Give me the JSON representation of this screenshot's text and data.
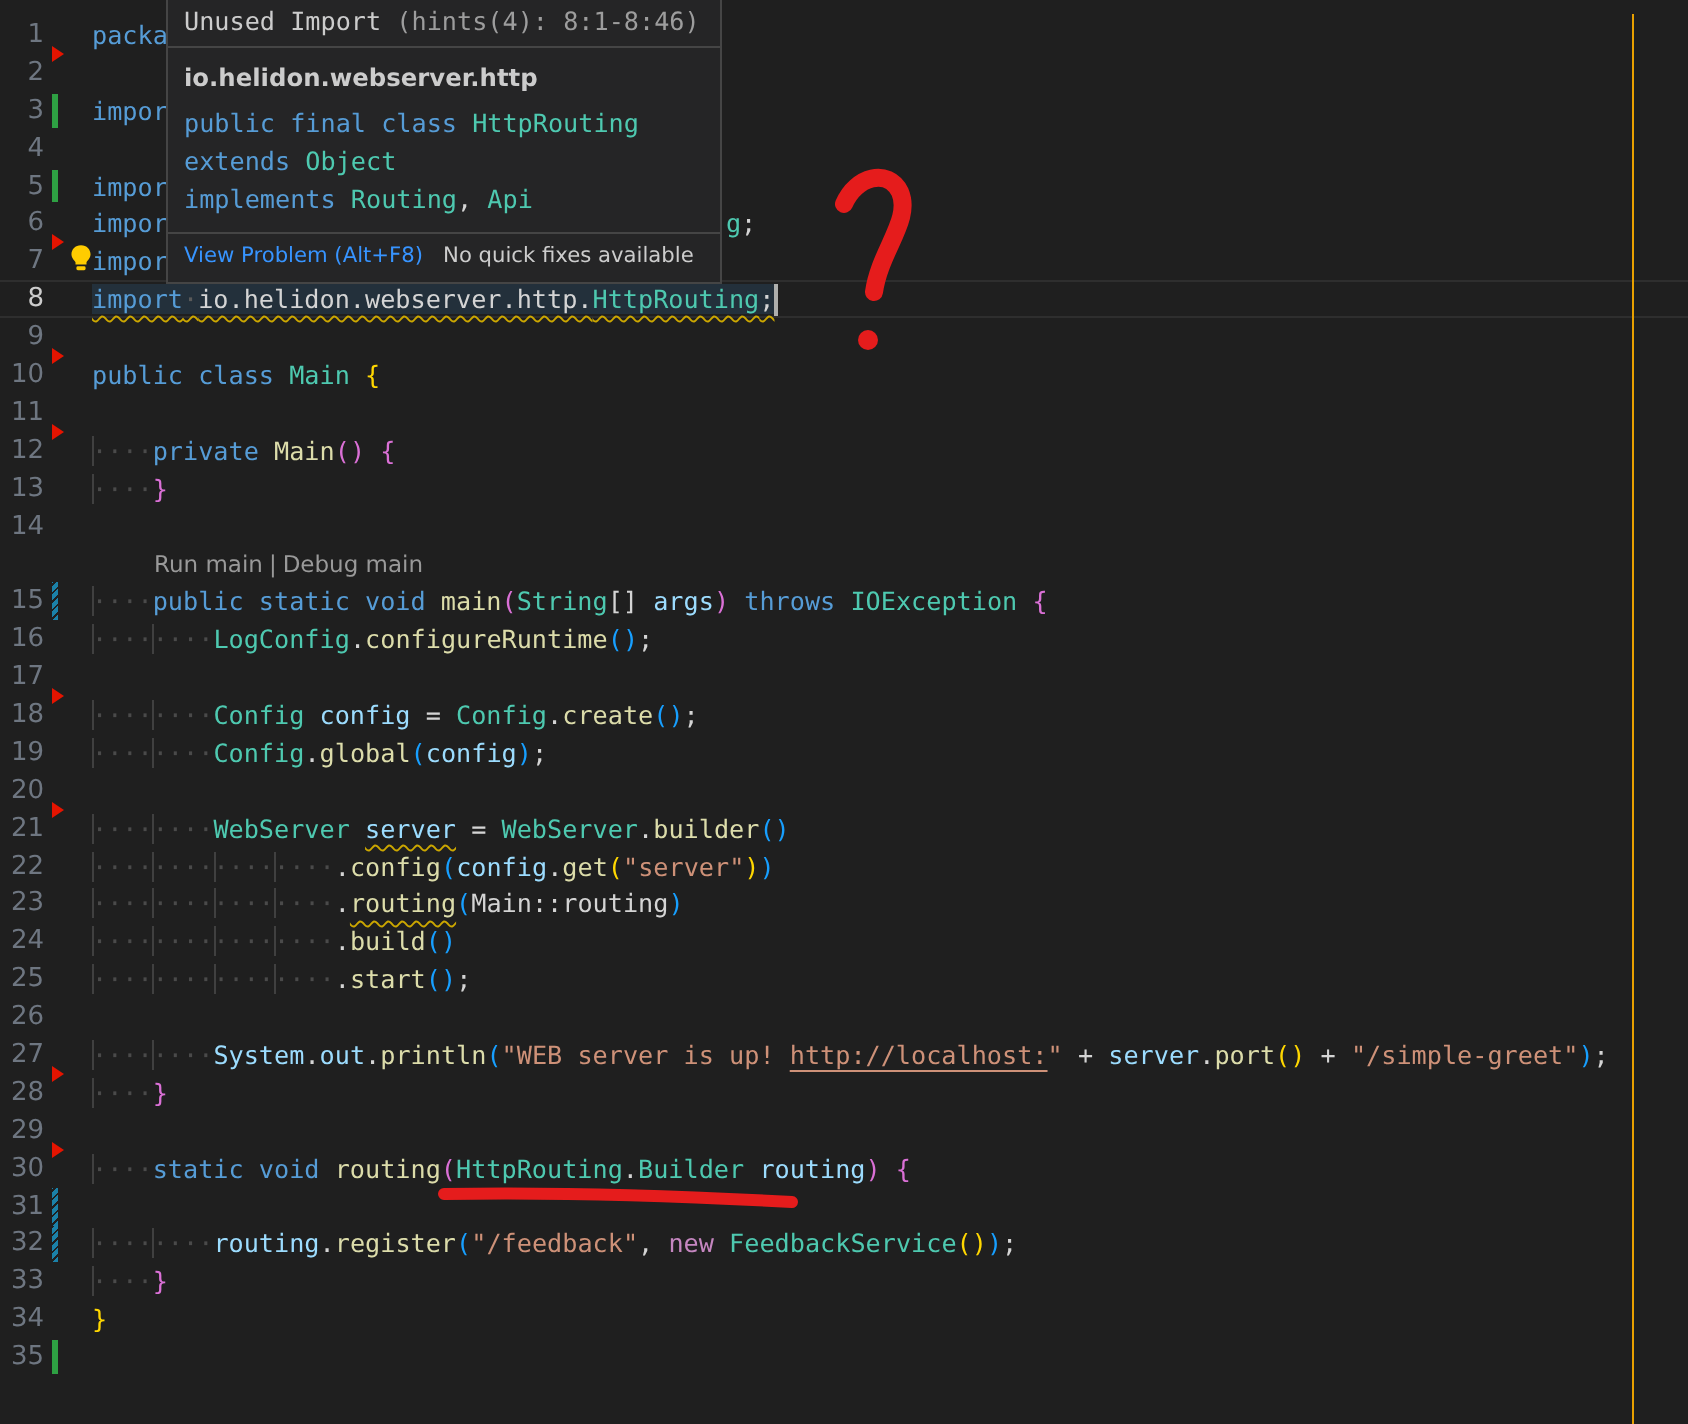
{
  "editor": {
    "lines": [
      {
        "kind": "code",
        "number": "1",
        "selected": false,
        "gutter": {
          "kind": "arrow"
        },
        "tokens": [
          {
            "text": "packa",
            "kind": "keyword"
          }
        ]
      },
      {
        "kind": "code",
        "number": "2",
        "selected": false
      },
      {
        "kind": "code",
        "number": "3",
        "selected": false,
        "gutter": {
          "kind": "added"
        },
        "tokens": [
          {
            "text": "impor",
            "kind": "keyword"
          }
        ]
      },
      {
        "kind": "code",
        "number": "4",
        "selected": false
      },
      {
        "kind": "code",
        "number": "5",
        "selected": false,
        "gutter": {
          "kind": "added"
        },
        "tokens": [
          {
            "text": "impor",
            "kind": "keyword"
          }
        ]
      },
      {
        "kind": "code",
        "number": "6",
        "selected": false,
        "gutter": {
          "kind": "arrow"
        },
        "tokens": [
          {
            "text": "impor",
            "kind": "keyword"
          },
          {
            "text": "g",
            "kind": "type",
            "beyond_popup": true
          },
          {
            "text": ";",
            "kind": "plain"
          }
        ]
      },
      {
        "kind": "code",
        "number": "7",
        "selected": false,
        "lightbulb": true,
        "tokens": [
          {
            "text": "impor",
            "kind": "keyword"
          }
        ]
      },
      {
        "kind": "code",
        "number": "8",
        "selected": true,
        "tokens": [
          {
            "text": "import",
            "kind": "keyword",
            "squiggle": true
          },
          {
            "text": "·",
            "kind": "space",
            "squiggle": true
          },
          {
            "text": "io.helidon.webserver.http.",
            "kind": "plain",
            "squiggle": true
          },
          {
            "text": "HttpRouting",
            "kind": "type",
            "squiggle": true
          },
          {
            "text": ";",
            "kind": "plain",
            "squiggle": true
          }
        ]
      },
      {
        "kind": "code",
        "number": "9",
        "selected": false,
        "gutter": {
          "kind": "arrow"
        }
      },
      {
        "kind": "code",
        "number": "10",
        "selected": false,
        "tokens": [
          {
            "text": "public class ",
            "kind": "keyword"
          },
          {
            "text": "Main ",
            "kind": "type"
          },
          {
            "text": "{",
            "kind": "bracket1"
          }
        ]
      },
      {
        "kind": "code",
        "number": "11",
        "selected": false,
        "gutter": {
          "kind": "arrow"
        }
      },
      {
        "kind": "code",
        "number": "12",
        "selected": false,
        "tokens": [
          {
            "text": "····",
            "kind": "indent"
          },
          {
            "text": "private ",
            "kind": "keyword"
          },
          {
            "text": "Main",
            "kind": "function"
          },
          {
            "text": "() {",
            "kind": "bracket2"
          }
        ]
      },
      {
        "kind": "code",
        "number": "13",
        "selected": false,
        "tokens": [
          {
            "text": "····",
            "kind": "indent"
          },
          {
            "text": "}",
            "kind": "bracket2"
          }
        ]
      },
      {
        "kind": "code",
        "number": "14",
        "selected": false
      },
      {
        "kind": "codelens",
        "links": [
          "Run main",
          "Debug main"
        ],
        "separator": "|"
      },
      {
        "kind": "code",
        "number": "15",
        "selected": false,
        "gutter": {
          "kind": "modified"
        },
        "tokens": [
          {
            "text": "····",
            "kind": "indent"
          },
          {
            "text": "public static void ",
            "kind": "keyword"
          },
          {
            "text": "main",
            "kind": "function"
          },
          {
            "text": "(",
            "kind": "bracket2"
          },
          {
            "text": "String",
            "kind": "type"
          },
          {
            "text": "[] ",
            "kind": "plain"
          },
          {
            "text": "args",
            "kind": "variable"
          },
          {
            "text": ")",
            "kind": "bracket2"
          },
          {
            "text": " throws ",
            "kind": "keyword"
          },
          {
            "text": "IOException ",
            "kind": "type"
          },
          {
            "text": "{",
            "kind": "bracket2"
          }
        ]
      },
      {
        "kind": "code",
        "number": "16",
        "selected": false,
        "tokens": [
          {
            "text": "····",
            "kind": "indent"
          },
          {
            "text": "····",
            "kind": "indent"
          },
          {
            "text": "LogConfig",
            "kind": "type"
          },
          {
            "text": ".",
            "kind": "plain"
          },
          {
            "text": "configureRuntime",
            "kind": "function"
          },
          {
            "text": "()",
            "kind": "bracket3"
          },
          {
            "text": ";",
            "kind": "plain"
          }
        ]
      },
      {
        "kind": "code",
        "number": "17",
        "selected": false,
        "gutter": {
          "kind": "arrow"
        }
      },
      {
        "kind": "code",
        "number": "18",
        "selected": false,
        "tokens": [
          {
            "text": "····",
            "kind": "indent"
          },
          {
            "text": "····",
            "kind": "indent"
          },
          {
            "text": "Config ",
            "kind": "type"
          },
          {
            "text": "config",
            "kind": "variable"
          },
          {
            "text": " = ",
            "kind": "plain"
          },
          {
            "text": "Config",
            "kind": "type"
          },
          {
            "text": ".",
            "kind": "plain"
          },
          {
            "text": "create",
            "kind": "function"
          },
          {
            "text": "()",
            "kind": "bracket3"
          },
          {
            "text": ";",
            "kind": "plain"
          }
        ]
      },
      {
        "kind": "code",
        "number": "19",
        "selected": false,
        "tokens": [
          {
            "text": "····",
            "kind": "indent"
          },
          {
            "text": "····",
            "kind": "indent"
          },
          {
            "text": "Config",
            "kind": "type"
          },
          {
            "text": ".",
            "kind": "plain"
          },
          {
            "text": "global",
            "kind": "function"
          },
          {
            "text": "(",
            "kind": "bracket3"
          },
          {
            "text": "config",
            "kind": "variable"
          },
          {
            "text": ")",
            "kind": "bracket3"
          },
          {
            "text": ";",
            "kind": "plain"
          }
        ]
      },
      {
        "kind": "code",
        "number": "20",
        "selected": false,
        "gutter": {
          "kind": "arrow"
        }
      },
      {
        "kind": "code",
        "number": "21",
        "selected": false,
        "tokens": [
          {
            "text": "····",
            "kind": "indent"
          },
          {
            "text": "····",
            "kind": "indent"
          },
          {
            "text": "WebServer ",
            "kind": "type"
          },
          {
            "text": "server",
            "kind": "variable",
            "squiggle": true
          },
          {
            "text": " = ",
            "kind": "plain"
          },
          {
            "text": "WebServer",
            "kind": "type"
          },
          {
            "text": ".",
            "kind": "plain"
          },
          {
            "text": "builder",
            "kind": "function"
          },
          {
            "text": "()",
            "kind": "bracket3"
          }
        ]
      },
      {
        "kind": "code",
        "number": "22",
        "selected": false,
        "tokens": [
          {
            "text": "····",
            "kind": "indent"
          },
          {
            "text": "····",
            "kind": "indent"
          },
          {
            "text": "····",
            "kind": "indent"
          },
          {
            "text": "····",
            "kind": "indent"
          },
          {
            "text": ".",
            "kind": "plain"
          },
          {
            "text": "config",
            "kind": "function"
          },
          {
            "text": "(",
            "kind": "bracket3"
          },
          {
            "text": "config",
            "kind": "variable"
          },
          {
            "text": ".",
            "kind": "plain"
          },
          {
            "text": "get",
            "kind": "function"
          },
          {
            "text": "(",
            "kind": "bracket1"
          },
          {
            "text": "\"server\"",
            "kind": "string"
          },
          {
            "text": ")",
            "kind": "bracket1"
          },
          {
            "text": ")",
            "kind": "bracket3"
          }
        ]
      },
      {
        "kind": "code",
        "number": "23",
        "selected": false,
        "tokens": [
          {
            "text": "····",
            "kind": "indent"
          },
          {
            "text": "····",
            "kind": "indent"
          },
          {
            "text": "····",
            "kind": "indent"
          },
          {
            "text": "····",
            "kind": "indent"
          },
          {
            "text": ".",
            "kind": "plain"
          },
          {
            "text": "routing",
            "kind": "function",
            "squiggle": true
          },
          {
            "text": "(",
            "kind": "bracket3"
          },
          {
            "text": "Main::routing",
            "kind": "plain"
          },
          {
            "text": ")",
            "kind": "bracket3"
          }
        ]
      },
      {
        "kind": "code",
        "number": "24",
        "selected": false,
        "tokens": [
          {
            "text": "····",
            "kind": "indent"
          },
          {
            "text": "····",
            "kind": "indent"
          },
          {
            "text": "····",
            "kind": "indent"
          },
          {
            "text": "····",
            "kind": "indent"
          },
          {
            "text": ".",
            "kind": "plain"
          },
          {
            "text": "build",
            "kind": "function"
          },
          {
            "text": "()",
            "kind": "bracket3"
          }
        ]
      },
      {
        "kind": "code",
        "number": "25",
        "selected": false,
        "tokens": [
          {
            "text": "····",
            "kind": "indent"
          },
          {
            "text": "····",
            "kind": "indent"
          },
          {
            "text": "····",
            "kind": "indent"
          },
          {
            "text": "····",
            "kind": "indent"
          },
          {
            "text": ".",
            "kind": "plain"
          },
          {
            "text": "start",
            "kind": "function"
          },
          {
            "text": "()",
            "kind": "bracket3"
          },
          {
            "text": ";",
            "kind": "plain"
          }
        ]
      },
      {
        "kind": "code",
        "number": "26",
        "selected": false
      },
      {
        "kind": "code",
        "number": "27",
        "selected": false,
        "gutter": {
          "kind": "arrow"
        },
        "tokens": [
          {
            "text": "····",
            "kind": "indent"
          },
          {
            "text": "····",
            "kind": "indent"
          },
          {
            "text": "System",
            "kind": "variable"
          },
          {
            "text": ".",
            "kind": "plain"
          },
          {
            "text": "out",
            "kind": "variable"
          },
          {
            "text": ".",
            "kind": "plain"
          },
          {
            "text": "println",
            "kind": "function"
          },
          {
            "text": "(",
            "kind": "bracket3"
          },
          {
            "text": "\"WEB server is up! ",
            "kind": "string"
          },
          {
            "text": "http://localhost:",
            "kind": "link"
          },
          {
            "text": "\"",
            "kind": "string"
          },
          {
            "text": " + ",
            "kind": "plain"
          },
          {
            "text": "server",
            "kind": "variable"
          },
          {
            "text": ".",
            "kind": "plain"
          },
          {
            "text": "port",
            "kind": "function"
          },
          {
            "text": "()",
            "kind": "bracket1"
          },
          {
            "text": " + ",
            "kind": "plain"
          },
          {
            "text": "\"/simple-greet\"",
            "kind": "string"
          },
          {
            "text": ")",
            "kind": "bracket3"
          },
          {
            "text": ";",
            "kind": "plain"
          }
        ]
      },
      {
        "kind": "code",
        "number": "28",
        "selected": false,
        "tokens": [
          {
            "text": "····",
            "kind": "indent"
          },
          {
            "text": "}",
            "kind": "bracket2"
          }
        ]
      },
      {
        "kind": "code",
        "number": "29",
        "selected": false,
        "gutter": {
          "kind": "arrow"
        }
      },
      {
        "kind": "code",
        "number": "30",
        "selected": false,
        "tokens": [
          {
            "text": "····",
            "kind": "indent"
          },
          {
            "text": "static void ",
            "kind": "keyword"
          },
          {
            "text": "routing",
            "kind": "function"
          },
          {
            "text": "(",
            "kind": "bracket2"
          },
          {
            "text": "HttpRouting",
            "kind": "type"
          },
          {
            "text": ".",
            "kind": "plain"
          },
          {
            "text": "Builder ",
            "kind": "type"
          },
          {
            "text": "routing",
            "kind": "variable"
          },
          {
            "text": ") {",
            "kind": "bracket2"
          }
        ]
      },
      {
        "kind": "code",
        "number": "31",
        "selected": false,
        "gutter": {
          "kind": "modified"
        }
      },
      {
        "kind": "code",
        "number": "32",
        "selected": false,
        "gutter": {
          "kind": "modified"
        },
        "tokens": [
          {
            "text": "····",
            "kind": "indent"
          },
          {
            "text": "····",
            "kind": "indent"
          },
          {
            "text": "routing",
            "kind": "variable"
          },
          {
            "text": ".",
            "kind": "plain"
          },
          {
            "text": "register",
            "kind": "function"
          },
          {
            "text": "(",
            "kind": "bracket3"
          },
          {
            "text": "\"/feedback\"",
            "kind": "string"
          },
          {
            "text": ", ",
            "kind": "plain"
          },
          {
            "text": "new ",
            "kind": "control"
          },
          {
            "text": "FeedbackService",
            "kind": "type"
          },
          {
            "text": "()",
            "kind": "bracket1"
          },
          {
            "text": ")",
            "kind": "bracket3"
          },
          {
            "text": ";",
            "kind": "plain"
          }
        ]
      },
      {
        "kind": "code",
        "number": "33",
        "selected": false,
        "tokens": [
          {
            "text": "····",
            "kind": "indent"
          },
          {
            "text": "}",
            "kind": "bracket2"
          }
        ]
      },
      {
        "kind": "code",
        "number": "34",
        "selected": false,
        "tokens": [
          {
            "text": "}",
            "kind": "bracket1"
          }
        ]
      },
      {
        "kind": "code",
        "number": "35",
        "selected": false,
        "gutter": {
          "kind": "added"
        }
      }
    ]
  },
  "hover_popup": {
    "title": "Unused Import",
    "detail": "(hints(4): 8:1-8:46)",
    "package": "io.helidon.webserver.http",
    "signature": [
      [
        {
          "text": "public final class ",
          "kind": "keyword"
        },
        {
          "text": "HttpRouting",
          "kind": "type"
        }
      ],
      [
        {
          "text": "extends ",
          "kind": "keyword"
        },
        {
          "text": "Object",
          "kind": "type"
        }
      ],
      [
        {
          "text": "implements ",
          "kind": "keyword"
        },
        {
          "text": "Routing",
          "kind": "type"
        },
        {
          "text": ", ",
          "kind": "plain"
        },
        {
          "text": "Api",
          "kind": "type"
        }
      ]
    ],
    "view_problem": "View Problem (Alt+F8)",
    "quick_fix_note": "No quick fixes available"
  },
  "hand_drawn_question_mark": true,
  "hand_drawn_underline": true
}
